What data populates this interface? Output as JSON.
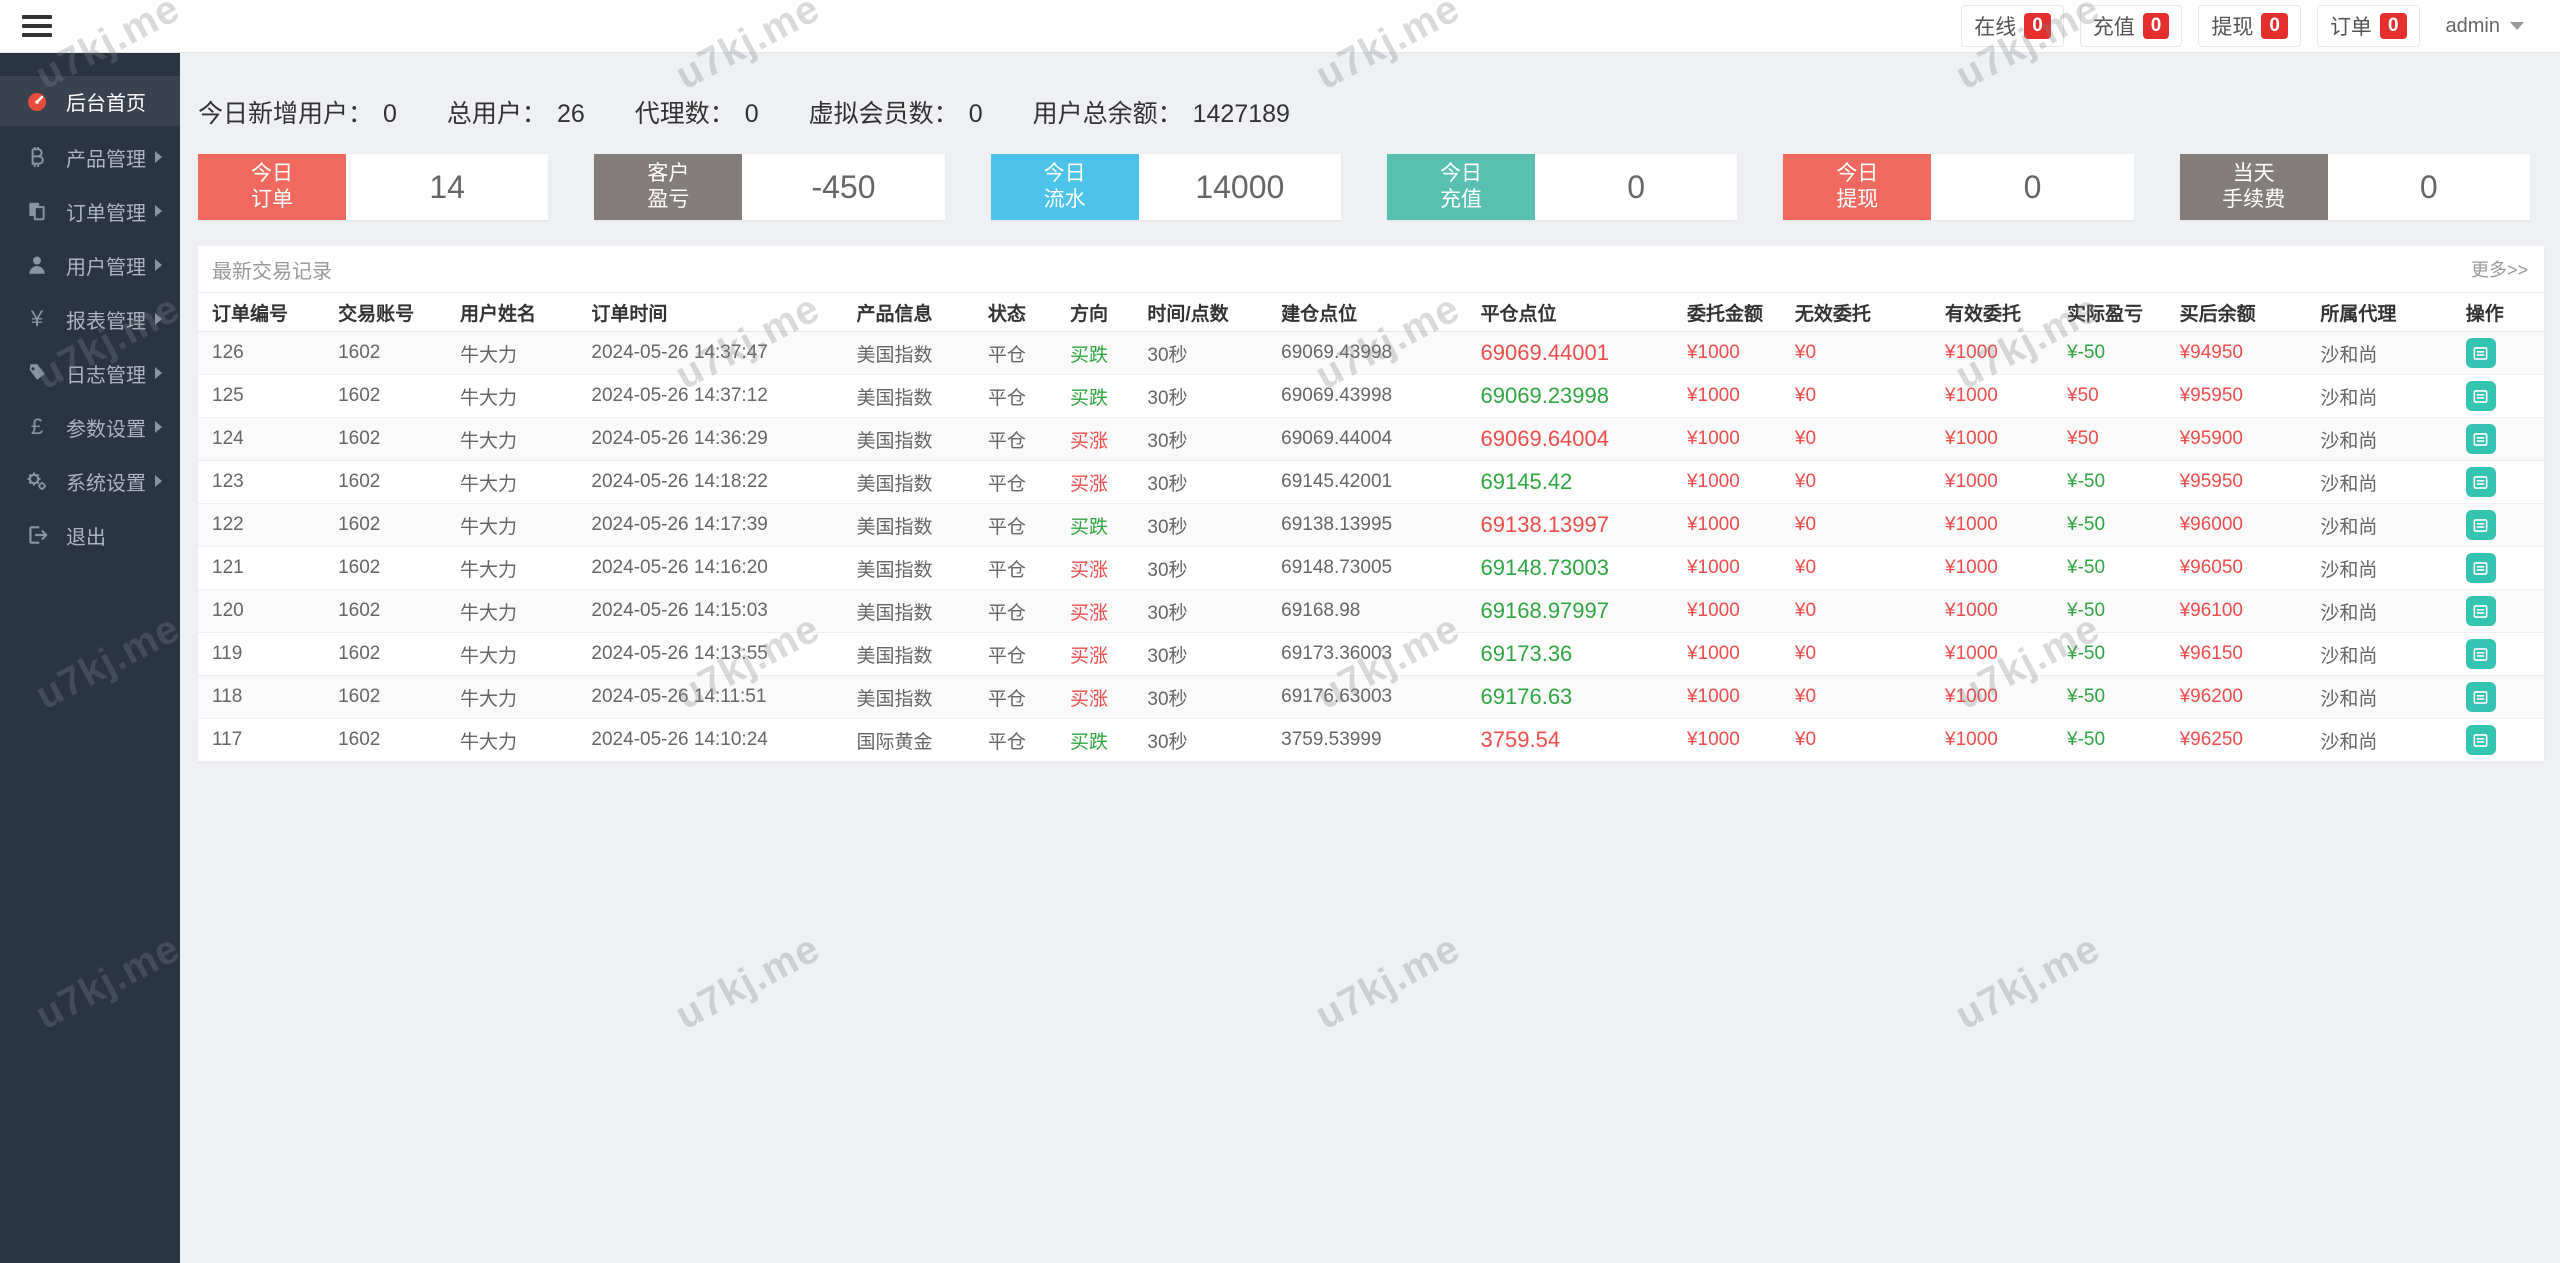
{
  "watermark": {
    "text": "u7kj.me"
  },
  "colors": {
    "red": "#ef4c4c",
    "green": "#2fa640",
    "badge_red": "#e52e2e",
    "accent_teal": "#35c3b2",
    "sidebar_bg": "#2a3542"
  },
  "topbar": {
    "stats": [
      {
        "label": "在线",
        "count": "0"
      },
      {
        "label": "充值",
        "count": "0"
      },
      {
        "label": "提现",
        "count": "0"
      },
      {
        "label": "订单",
        "count": "0"
      }
    ],
    "user": {
      "name": "admin"
    }
  },
  "sidebar": {
    "items": [
      {
        "label": "后台首页",
        "icon": "dashboard-icon",
        "active": true
      },
      {
        "label": "产品管理",
        "icon": "product-icon"
      },
      {
        "label": "订单管理",
        "icon": "orders-icon"
      },
      {
        "label": "用户管理",
        "icon": "users-icon"
      },
      {
        "label": "报表管理",
        "icon": "report-icon"
      },
      {
        "label": "日志管理",
        "icon": "logs-icon"
      },
      {
        "label": "参数设置",
        "icon": "params-icon"
      },
      {
        "label": "系统设置",
        "icon": "system-icon"
      },
      {
        "label": "退出",
        "icon": "logout-icon"
      }
    ]
  },
  "summary": {
    "items": [
      {
        "label": "今日新增用户：",
        "value": "0"
      },
      {
        "label": "总用户：",
        "value": "26"
      },
      {
        "label": "代理数：",
        "value": "0"
      },
      {
        "label": "虚拟会员数：",
        "value": "0"
      },
      {
        "label": "用户总余额：",
        "value": "1427189"
      }
    ]
  },
  "cards": [
    {
      "line1": "今日",
      "line2": "订单",
      "value": "14",
      "color": "#f0695e"
    },
    {
      "line1": "客户",
      "line2": "盈亏",
      "value": "-450",
      "color": "#837e7b"
    },
    {
      "line1": "今日",
      "line2": "流水",
      "value": "14000",
      "color": "#4ec3e9"
    },
    {
      "line1": "今日",
      "line2": "充值",
      "value": "0",
      "color": "#58bfb1"
    },
    {
      "line1": "今日",
      "line2": "提现",
      "value": "0",
      "color": "#f0695e"
    },
    {
      "line1": "当天",
      "line2": "手续费",
      "value": "0",
      "color": "#837e7b"
    }
  ],
  "panel": {
    "title": "最新交易记录",
    "more": "更多>>"
  },
  "table": {
    "columns": [
      "订单编号",
      "交易账号",
      "用户姓名",
      "订单时间",
      "产品信息",
      "状态",
      "方向",
      "时间/点数",
      "建仓点位",
      "平仓点位",
      "委托金额",
      "无效委托",
      "有效委托",
      "实际盈亏",
      "买后余额",
      "所属代理",
      "操作"
    ],
    "col_widths": [
      "5.8%",
      "5.2%",
      "5.6%",
      "11.3%",
      "5.6%",
      "3.5%",
      "3.3%",
      "5.7%",
      "8.5%",
      "8.8%",
      "4.6%",
      "6.4%",
      "5.2%",
      "4.8%",
      "6.0%",
      "6.2%",
      "3.5%"
    ],
    "rows": [
      {
        "id": "126",
        "account": "1602",
        "name": "牛大力",
        "time": "2024-05-26 14:37:47",
        "product": "美国指数",
        "status": "平仓",
        "direction": "买跌",
        "direction_color": "green",
        "period": "30秒",
        "open": "69069.43998",
        "close": "69069.44001",
        "close_color": "red",
        "amount": "¥1000",
        "invalid": "¥0",
        "valid": "¥1000",
        "profit": "¥-50",
        "profit_color": "green",
        "balance": "¥94950",
        "agent": "沙和尚"
      },
      {
        "id": "125",
        "account": "1602",
        "name": "牛大力",
        "time": "2024-05-26 14:37:12",
        "product": "美国指数",
        "status": "平仓",
        "direction": "买跌",
        "direction_color": "green",
        "period": "30秒",
        "open": "69069.43998",
        "close": "69069.23998",
        "close_color": "green",
        "amount": "¥1000",
        "invalid": "¥0",
        "valid": "¥1000",
        "profit": "¥50",
        "profit_color": "red",
        "balance": "¥95950",
        "agent": "沙和尚"
      },
      {
        "id": "124",
        "account": "1602",
        "name": "牛大力",
        "time": "2024-05-26 14:36:29",
        "product": "美国指数",
        "status": "平仓",
        "direction": "买涨",
        "direction_color": "red",
        "period": "30秒",
        "open": "69069.44004",
        "close": "69069.64004",
        "close_color": "red",
        "amount": "¥1000",
        "invalid": "¥0",
        "valid": "¥1000",
        "profit": "¥50",
        "profit_color": "red",
        "balance": "¥95900",
        "agent": "沙和尚"
      },
      {
        "id": "123",
        "account": "1602",
        "name": "牛大力",
        "time": "2024-05-26 14:18:22",
        "product": "美国指数",
        "status": "平仓",
        "direction": "买涨",
        "direction_color": "red",
        "period": "30秒",
        "open": "69145.42001",
        "close": "69145.42",
        "close_color": "green",
        "amount": "¥1000",
        "invalid": "¥0",
        "valid": "¥1000",
        "profit": "¥-50",
        "profit_color": "green",
        "balance": "¥95950",
        "agent": "沙和尚"
      },
      {
        "id": "122",
        "account": "1602",
        "name": "牛大力",
        "time": "2024-05-26 14:17:39",
        "product": "美国指数",
        "status": "平仓",
        "direction": "买跌",
        "direction_color": "green",
        "period": "30秒",
        "open": "69138.13995",
        "close": "69138.13997",
        "close_color": "red",
        "amount": "¥1000",
        "invalid": "¥0",
        "valid": "¥1000",
        "profit": "¥-50",
        "profit_color": "green",
        "balance": "¥96000",
        "agent": "沙和尚"
      },
      {
        "id": "121",
        "account": "1602",
        "name": "牛大力",
        "time": "2024-05-26 14:16:20",
        "product": "美国指数",
        "status": "平仓",
        "direction": "买涨",
        "direction_color": "red",
        "period": "30秒",
        "open": "69148.73005",
        "close": "69148.73003",
        "close_color": "green",
        "amount": "¥1000",
        "invalid": "¥0",
        "valid": "¥1000",
        "profit": "¥-50",
        "profit_color": "green",
        "balance": "¥96050",
        "agent": "沙和尚"
      },
      {
        "id": "120",
        "account": "1602",
        "name": "牛大力",
        "time": "2024-05-26 14:15:03",
        "product": "美国指数",
        "status": "平仓",
        "direction": "买涨",
        "direction_color": "red",
        "period": "30秒",
        "open": "69168.98",
        "close": "69168.97997",
        "close_color": "green",
        "amount": "¥1000",
        "invalid": "¥0",
        "valid": "¥1000",
        "profit": "¥-50",
        "profit_color": "green",
        "balance": "¥96100",
        "agent": "沙和尚"
      },
      {
        "id": "119",
        "account": "1602",
        "name": "牛大力",
        "time": "2024-05-26 14:13:55",
        "product": "美国指数",
        "status": "平仓",
        "direction": "买涨",
        "direction_color": "red",
        "period": "30秒",
        "open": "69173.36003",
        "close": "69173.36",
        "close_color": "green",
        "amount": "¥1000",
        "invalid": "¥0",
        "valid": "¥1000",
        "profit": "¥-50",
        "profit_color": "green",
        "balance": "¥96150",
        "agent": "沙和尚"
      },
      {
        "id": "118",
        "account": "1602",
        "name": "牛大力",
        "time": "2024-05-26 14:11:51",
        "product": "美国指数",
        "status": "平仓",
        "direction": "买涨",
        "direction_color": "red",
        "period": "30秒",
        "open": "69176.63003",
        "close": "69176.63",
        "close_color": "green",
        "amount": "¥1000",
        "invalid": "¥0",
        "valid": "¥1000",
        "profit": "¥-50",
        "profit_color": "green",
        "balance": "¥96200",
        "agent": "沙和尚"
      },
      {
        "id": "117",
        "account": "1602",
        "name": "牛大力",
        "time": "2024-05-26 14:10:24",
        "product": "国际黄金",
        "status": "平仓",
        "direction": "买跌",
        "direction_color": "green",
        "period": "30秒",
        "open": "3759.53999",
        "close": "3759.54",
        "close_color": "red",
        "amount": "¥1000",
        "invalid": "¥0",
        "valid": "¥1000",
        "profit": "¥-50",
        "profit_color": "green",
        "balance": "¥96250",
        "agent": "沙和尚"
      }
    ]
  }
}
